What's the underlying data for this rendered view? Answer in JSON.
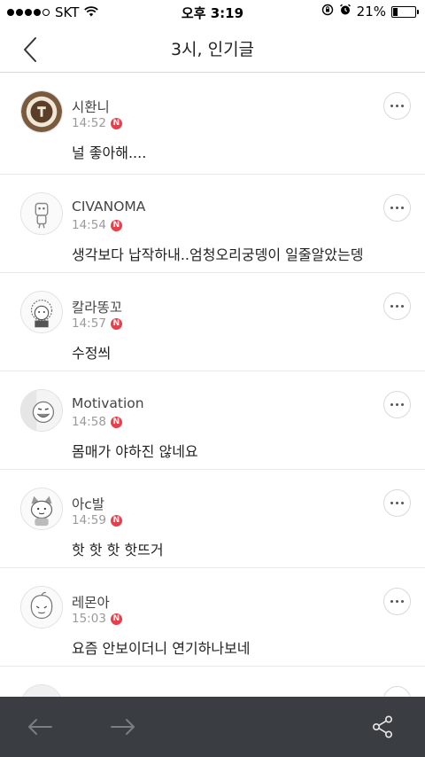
{
  "status_bar": {
    "carrier": "SKT",
    "time": "오후 3:19",
    "battery": "21%",
    "battery_level": 0.21,
    "signal_bars": 4,
    "icons": [
      "wifi-icon",
      "rotation-lock-icon",
      "alarm-icon",
      "battery-icon"
    ]
  },
  "header": {
    "title": "3시, 인기글",
    "back_icon": "chevron-left-icon"
  },
  "comments": [
    {
      "author": "시환니",
      "time": "14:52",
      "badge": "N",
      "text": "널 좋아해....",
      "avatar": "coffee-logo"
    },
    {
      "author": "CIVANOMA",
      "time": "14:54",
      "badge": "N",
      "text": "생각보다 납작하내..엄청오리궁뎅이 일줄알았는뎅",
      "avatar": "robot-character"
    },
    {
      "author": "칼라똥꼬",
      "time": "14:57",
      "badge": "N",
      "text": "수정씌",
      "avatar": "character-illustration"
    },
    {
      "author": "Motivation",
      "time": "14:58",
      "badge": "N",
      "text": "몸매가 야하진 않네요",
      "avatar": "laughing-character"
    },
    {
      "author": "아c발",
      "time": "14:59",
      "badge": "N",
      "text": "핫 핫 핫 핫뜨거",
      "avatar": "cat-character"
    },
    {
      "author": "레몬아",
      "time": "15:03",
      "badge": "N",
      "text": "요즘 안보이더니 연기하나보네",
      "avatar": "peach-character"
    }
  ],
  "bottom_bar": {
    "icons": [
      "arrow-left-icon",
      "arrow-right-icon",
      "share-icon"
    ]
  },
  "colors": {
    "badge": "#e8404a",
    "bottom_bar_bg": "#3a3d42",
    "divider": "#e9e9e9"
  }
}
